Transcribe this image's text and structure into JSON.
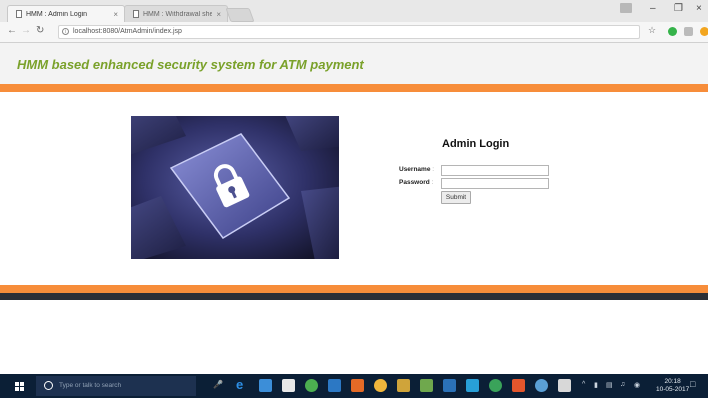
{
  "browser": {
    "tabs": [
      {
        "title": "HMM : Admin Login",
        "active": true
      },
      {
        "title": "HMM : Withdrawal  shee",
        "active": false
      }
    ],
    "address": "localhost:8080/AtmAdmin/index.jsp"
  },
  "header": {
    "title": "HMM based enhanced security system for ATM payment"
  },
  "login": {
    "title": "Admin Login",
    "username_label": "Username",
    "password_label": "Password",
    "colon": ":",
    "username_value": "",
    "password_value": "",
    "submit_label": "Submit"
  },
  "taskbar": {
    "search_placeholder": "Type or talk to search",
    "time": "20:18",
    "date": "10-05-2017"
  },
  "colors": {
    "title_green": "#7aa12a",
    "orange_bar": "#f78d3a",
    "dark_bar": "#2d2f36",
    "taskbar": "#0b1f36"
  }
}
